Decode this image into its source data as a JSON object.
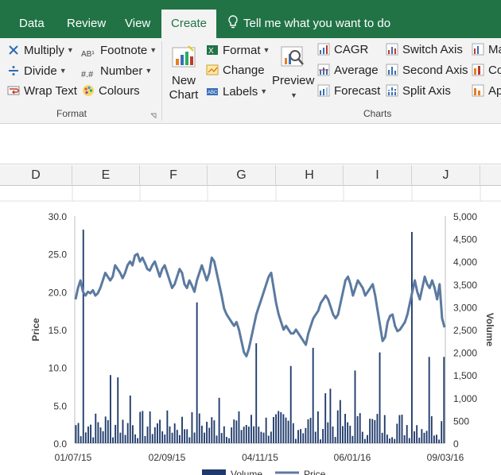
{
  "tabs": {
    "data": "Data",
    "review": "Review",
    "view": "View",
    "create": "Create",
    "tell_me": "Tell me what you want to do"
  },
  "ribbon": {
    "multiply": "Multiply",
    "divide": "Divide",
    "wrap_text": "Wrap Text",
    "footnote": "Footnote",
    "number": "Number",
    "colours": "Colours",
    "format_group": "Format",
    "new_chart_line1": "New",
    "new_chart_line2": "Chart",
    "format": "Format",
    "change": "Change",
    "labels": "Labels",
    "preview": "Preview",
    "cagr": "CAGR",
    "average": "Average",
    "forecast": "Forecast",
    "switch_axis": "Switch Axis",
    "second_axis": "Second Axis",
    "split_axis": "Split Axis",
    "ma": "Ma",
    "co": "Co",
    "ap": "Ap",
    "charts_group": "Charts"
  },
  "columns": [
    "D",
    "E",
    "F",
    "G",
    "H",
    "I",
    "J"
  ],
  "colors": {
    "excel_green": "#217346",
    "volume": "#1f3a6b",
    "price": "#5b7aa0"
  },
  "chart_data": {
    "type": "bar+line",
    "xlabel": "",
    "ylabel": "Price",
    "y2label": "Volume",
    "x_ticks": [
      "01/07/15",
      "02/09/15",
      "04/11/15",
      "06/01/16",
      "09/03/16"
    ],
    "ylim": [
      0,
      30
    ],
    "y_ticks": [
      "0.0",
      "5.0",
      "10.0",
      "15.0",
      "20.0",
      "25.0",
      "30.0"
    ],
    "y2lim": [
      0,
      5000
    ],
    "y2_ticks": [
      "0",
      "500",
      "1,000",
      "1,500",
      "2,000",
      "2,500",
      "3,000",
      "3,500",
      "4,000",
      "4,500",
      "5,000"
    ],
    "legend": [
      "Volume",
      "Price"
    ],
    "series": [
      {
        "name": "Price",
        "values": [
          19.0,
          20.5,
          21.5,
          20.0,
          19.5,
          20.0,
          19.8,
          20.2,
          19.5,
          19.8,
          20.5,
          21.5,
          22.5,
          22.0,
          21.5,
          22.0,
          23.5,
          23.0,
          22.5,
          21.8,
          22.5,
          23.5,
          24.0,
          23.5,
          24.8,
          25.0,
          24.0,
          24.5,
          23.8,
          23.0,
          22.8,
          23.5,
          24.0,
          23.0,
          22.0,
          23.0,
          23.5,
          22.5,
          21.5,
          20.5,
          21.0,
          22.0,
          23.0,
          22.5,
          21.0,
          20.5,
          21.5,
          20.8,
          20.0,
          21.5,
          22.5,
          23.5,
          22.5,
          21.5,
          22.5,
          24.5,
          24.0,
          22.5,
          21.0,
          19.5,
          17.8,
          17.0,
          16.5,
          16.0,
          15.5,
          16.0,
          15.0,
          13.5,
          12.0,
          11.5,
          12.5,
          14.0,
          15.5,
          17.0,
          18.0,
          19.0,
          20.0,
          21.0,
          22.0,
          22.5,
          20.5,
          18.5,
          17.0,
          16.0,
          15.0,
          15.5,
          15.0,
          14.5,
          14.5,
          15.0,
          14.5,
          14.0,
          13.5,
          13.0,
          14.5,
          15.5,
          16.5,
          17.0,
          17.5,
          18.5,
          19.0,
          19.5,
          19.0,
          18.0,
          17.0,
          16.5,
          17.0,
          18.5,
          20.0,
          21.5,
          22.0,
          21.0,
          19.5,
          20.5,
          21.5,
          21.0,
          20.5,
          19.5,
          20.0,
          20.5,
          21.0,
          19.5,
          17.5,
          15.5,
          13.5,
          14.0,
          16.0,
          16.8,
          17.0,
          15.5,
          14.8,
          15.0,
          15.5,
          16.0,
          17.0,
          18.5,
          20.0,
          21.5,
          20.0,
          19.0,
          20.5,
          22.0,
          21.0,
          20.5,
          21.5,
          20.5,
          19.0,
          21.0,
          16.5,
          15.3
        ]
      }
    ]
  }
}
